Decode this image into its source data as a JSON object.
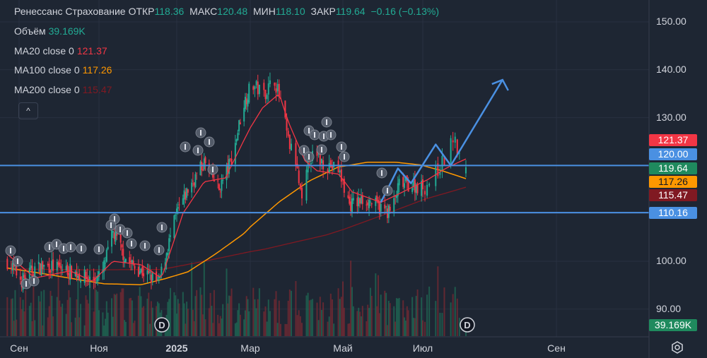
{
  "header": {
    "instrument": "Ренессанс Страхование",
    "open_label": "ОТКР",
    "open": "118.36",
    "high_label": "МАКС",
    "high": "120.48",
    "low_label": "МИН",
    "low": "118.10",
    "close_label": "ЗАКР",
    "close": "119.64",
    "change": "−0.16 (−0.13%)"
  },
  "indicators": {
    "volume_label": "Объём",
    "volume": "39.169K",
    "ma20_label": "MA20 close 0",
    "ma20": "121.37",
    "ma100_label": "MA100 close 0",
    "ma100": "117.26",
    "ma200_label": "MA200 close 0",
    "ma200": "115.47",
    "collapse": "^"
  },
  "colors": {
    "up": "#22ab94",
    "down": "#f23645",
    "ma20": "#f23645",
    "ma100": "#ff9800",
    "ma200": "#801922",
    "drawing": "#4a90e2",
    "level": "#4a90e2"
  },
  "chart_data": {
    "type": "candlestick",
    "title": "Ренессанс Страхование",
    "ylim": [
      85,
      155
    ],
    "y_ticks": [
      "150.00",
      "140.00",
      "130.00",
      "100.00",
      "90.00"
    ],
    "x_ticks": [
      "Сен",
      "Ноя",
      "2025",
      "Мар",
      "Май",
      "Июл",
      "Сен"
    ],
    "price_path": [
      [
        "2024-08-23",
        100
      ],
      [
        "2024-09-03",
        96
      ],
      [
        "2024-09-13",
        98.5
      ],
      [
        "2024-09-24",
        99
      ],
      [
        "2024-10-10",
        98
      ],
      [
        "2024-10-27",
        96
      ],
      [
        "2024-11-03",
        97
      ],
      [
        "2024-11-12",
        106
      ],
      [
        "2024-11-23",
        100
      ],
      [
        "2024-12-04",
        98
      ],
      [
        "2024-12-18",
        95.5
      ],
      [
        "2024-12-24",
        102
      ],
      [
        "2025-01-01",
        110
      ],
      [
        "2025-01-12",
        116
      ],
      [
        "2025-01-23",
        120.6
      ],
      [
        "2025-02-04",
        115
      ],
      [
        "2025-02-15",
        122
      ],
      [
        "2025-02-23",
        132.4
      ],
      [
        "2025-03-02",
        137
      ],
      [
        "2025-03-10",
        135
      ],
      [
        "2025-03-17",
        138
      ],
      [
        "2025-03-22",
        132
      ],
      [
        "2025-03-26",
        125
      ],
      [
        "2025-03-31",
        120.6
      ],
      [
        "2025-04-04",
        111.8
      ],
      [
        "2025-04-09",
        122
      ],
      [
        "2025-04-19",
        120.6
      ],
      [
        "2025-04-28",
        119
      ],
      [
        "2025-05-06",
        111.8
      ],
      [
        "2025-05-19",
        113
      ],
      [
        "2025-05-30",
        111
      ],
      [
        "2025-06-07",
        110.3
      ],
      [
        "2025-06-13",
        116
      ],
      [
        "2025-06-21",
        116
      ],
      [
        "2025-07-02",
        115.5
      ],
      [
        "2025-07-07",
        118.4
      ],
      [
        "2025-07-12",
        122
      ],
      [
        "2025-07-15",
        125.8
      ],
      [
        "2025-07-18",
        122
      ],
      [
        "2025-07-21",
        119.64
      ]
    ],
    "ma20_path": [
      [
        "2024-08-23",
        101.5
      ],
      [
        "2024-09-13",
        96.5
      ],
      [
        "2024-10-10",
        98
      ],
      [
        "2024-10-27",
        95.8
      ],
      [
        "2024-11-12",
        100
      ],
      [
        "2024-12-04",
        99.3
      ],
      [
        "2024-12-20",
        96.5
      ],
      [
        "2025-01-06",
        110
      ],
      [
        "2025-01-23",
        116.6
      ],
      [
        "2025-02-09",
        117.4
      ],
      [
        "2025-02-23",
        124.8
      ],
      [
        "2025-03-09",
        132
      ],
      [
        "2025-03-20",
        135
      ],
      [
        "2025-03-26",
        129.2
      ],
      [
        "2025-04-06",
        121
      ],
      [
        "2025-04-14",
        118.9
      ],
      [
        "2025-04-28",
        118.2
      ],
      [
        "2025-05-08",
        114.5
      ],
      [
        "2025-05-30",
        112.3
      ],
      [
        "2025-06-10",
        113.7
      ],
      [
        "2025-07-02",
        116.7
      ],
      [
        "2025-07-12",
        119.5
      ],
      [
        "2025-07-21",
        121.37
      ]
    ],
    "ma100_path": [
      [
        "2024-08-23",
        98.6
      ],
      [
        "2024-09-24",
        97.2
      ],
      [
        "2024-10-20",
        96
      ],
      [
        "2024-11-05",
        95.3
      ],
      [
        "2024-12-04",
        95.1
      ],
      [
        "2024-12-22",
        96.3
      ],
      [
        "2025-01-10",
        97.8
      ],
      [
        "2025-02-01",
        101.5
      ],
      [
        "2025-02-24",
        105.8
      ],
      [
        "2025-03-20",
        112.4
      ],
      [
        "2025-04-09",
        116.8
      ],
      [
        "2025-04-28",
        119.7
      ],
      [
        "2025-05-20",
        120.7
      ],
      [
        "2025-06-10",
        120.7
      ],
      [
        "2025-06-30",
        120.1
      ],
      [
        "2025-07-10",
        118.9
      ],
      [
        "2025-07-21",
        117.26
      ]
    ],
    "ma200_path": [
      [
        "2024-08-23",
        98.4
      ],
      [
        "2024-10-27",
        98.2
      ],
      [
        "2024-12-20",
        98.3
      ],
      [
        "2025-01-23",
        100
      ],
      [
        "2025-03-10",
        102.5
      ],
      [
        "2025-04-20",
        105.5
      ],
      [
        "2025-05-30",
        109.5
      ],
      [
        "2025-06-30",
        112.7
      ],
      [
        "2025-07-21",
        115.47
      ]
    ],
    "levels": [
      {
        "value": 120.0,
        "label": "120.00"
      },
      {
        "value": 110.16,
        "label": "110.16"
      }
    ],
    "drawing_zigzag": [
      [
        "2025-05-30",
        112.3
      ],
      [
        "2025-06-12",
        119.4
      ],
      [
        "2025-06-22",
        116.3
      ],
      [
        "2025-07-07",
        124.4
      ],
      [
        "2025-07-14",
        120
      ]
    ],
    "drawing_arrow_target": [
      "2025-08-07",
      137.9
    ],
    "price_tags": [
      {
        "label": "121.37",
        "value": 121.37,
        "color": "#f23645",
        "text": "#ffffff"
      },
      {
        "label": "120.00",
        "value": 120.0,
        "color": "#4a90e2",
        "text": "#ffffff"
      },
      {
        "label": "119.64",
        "value": 119.64,
        "color": "#1f8a5e",
        "text": "#ffffff"
      },
      {
        "label": "117.26",
        "value": 117.26,
        "color": "#ff9800",
        "text": "#131722"
      },
      {
        "label": "115.47",
        "value": 115.47,
        "color": "#801922",
        "text": "#ffffff"
      },
      {
        "label": "110.16",
        "value": 110.16,
        "color": "#4a90e2",
        "text": "#ffffff"
      }
    ],
    "volume_tag": "39.169K",
    "dividend_marker": "D"
  }
}
